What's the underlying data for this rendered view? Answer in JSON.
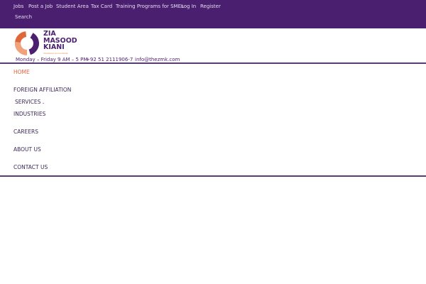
{
  "topbar": {
    "links": [
      "Jobs",
      "Post a Job",
      "Student Area",
      "Tax Card",
      "Training Programs for SMEs",
      "Log In",
      "Register",
      "Search"
    ]
  },
  "brand": {
    "line1": "ZIA",
    "line2": "MASOOD",
    "line3": "KIANI",
    "tagline": "Chartered Accountants"
  },
  "contact": {
    "hours": "Monday – Friday 9 AM – 5 PM",
    "phone": "+92 51 2111906-7",
    "email": "info@thezmk.com"
  },
  "nav": {
    "items": [
      "HOME",
      "FOREIGN AFFILIATION",
      "SERVICES",
      "INDUSTRIES",
      "CAREERS",
      "ABOUT US",
      "CONTACT US"
    ]
  },
  "colors": {
    "brand": "#4b1f6f",
    "accent": "#e0663a"
  }
}
